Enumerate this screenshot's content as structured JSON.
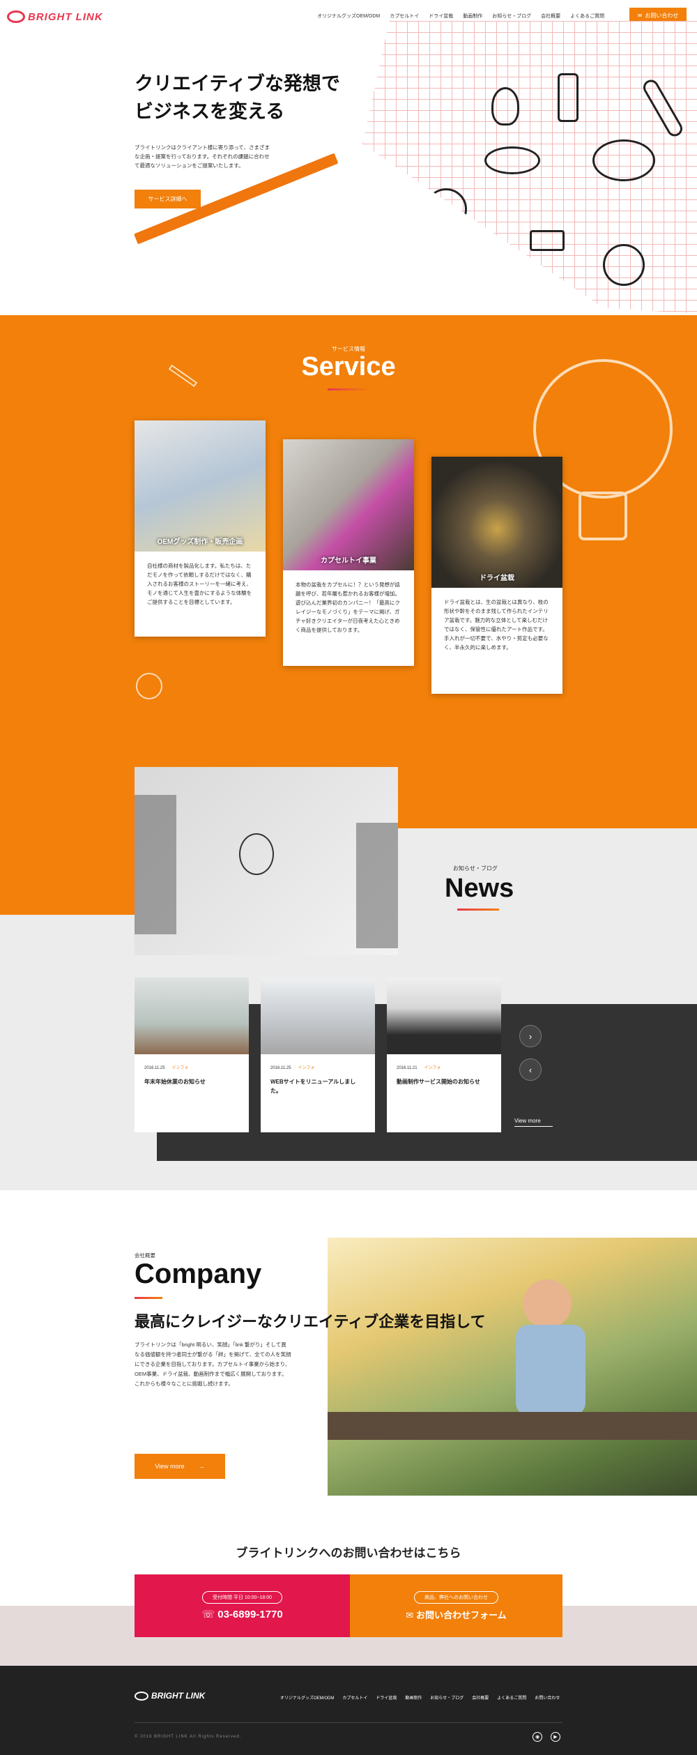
{
  "header": {
    "logo_text": "BRIGHT LINK",
    "nav": [
      "オリジナルグッズOEM/ODM",
      "カプセルトイ",
      "ドライ盆栽",
      "動画制作",
      "お知らせ・ブログ",
      "会社概要",
      "よくあるご質問"
    ],
    "contact_button": "お問い合わせ"
  },
  "hero": {
    "title_line1": "クリエイティブな発想で",
    "title_line2": "ビジネスを変える",
    "description": "ブライトリンクはクライアント様に寄り添って、さまざまな企画・提案を行っております。それぞれの課題に合わせて最適なソリューションをご提案いたします。",
    "button": "サービス詳細へ"
  },
  "service": {
    "subtitle": "サービス情報",
    "title": "Service",
    "cards": [
      {
        "caption": "OEMグッズ制作・販売企画",
        "text": "自社様の商材を製品化します。私たちは、ただモノを作って依頼しするだけではなく、購入されるお客様のストーリーを一緒に考え、モノを通じて人生を豊かにするような体験をご提供することを目標としています。"
      },
      {
        "caption": "カプセルトイ事業",
        "text": "本物の盆栽をカプセルに！？という発想が話題を呼び、若年層も惹かれるお客様が増加。遊び込んだ業界初のカンパニー！「最高にクレイジーなモノづくり」をテーマに掲げ、ガチャ好きクリエイターが日夜考えた心ときめく商品を提供しております。"
      },
      {
        "caption": "ドライ盆栽",
        "text": "ドライ盆栽とは、生の盆栽とは異なり、枝の形状や幹をそのまま残して作られたインテリア盆栽です。魅力的な立体として楽しむだけではなく、保管性に優れたアート作品です。手入れが一切不要で、水やり・剪定も必要なく、半永久的に楽しめます。"
      }
    ]
  },
  "news": {
    "subtitle": "お知らせ・ブログ",
    "title": "News",
    "items": [
      {
        "date": "2016.11.25",
        "category": "インフォ",
        "title": "年末年始休業のお知らせ"
      },
      {
        "date": "2016.11.25",
        "category": "インフォ",
        "title": "WEBサイトをリニューアルしました。"
      },
      {
        "date": "2016.11.21",
        "category": "インフォ",
        "title": "動画制作サービス開始のお知らせ"
      }
    ],
    "next": "›",
    "prev": "‹",
    "view_more": "View more"
  },
  "company": {
    "subtitle": "会社概要",
    "title": "Company",
    "headline": "最高にクレイジーなクリエイティブ企業を目指して",
    "description": "ブライトリンクは「bright 明るい、笑顔」「link 繋がり」そして異なる価値観を持つ者同士が繋がる「絆」を掲げて、全ての人を笑顔にできる企業を目指しております。カプセルトイ事業から始まり、OEM事業、ドライ盆栽、動画制作まで幅広く展開しております。これからも様々なことに挑戦し続けます。",
    "button": "View more",
    "button_arrow": "→"
  },
  "contact": {
    "title": "ブライトリンクへのお問い合わせはこちら",
    "phone_hours": "受付時間 平日 10:00~18:00",
    "phone": "03-6899-1770",
    "form_note": "商品、弊社へのお問い合わせ",
    "form_label": "お問い合わせフォーム"
  },
  "footer": {
    "logo_text": "BRIGHT LINK",
    "nav": [
      "オリジナルグッズOEM/ODM",
      "カプセルトイ",
      "ドライ盆栽",
      "動画制作",
      "お知らせ・ブログ",
      "会社概要",
      "よくあるご質問",
      "お問い合わせ"
    ],
    "copyright": "© 2016 BRIGHT LINK All Rights Reserved."
  },
  "colors": {
    "accent": "#f2800a",
    "brand_red": "#e8384f",
    "phone_red": "#e2174c",
    "dark": "#222222"
  }
}
